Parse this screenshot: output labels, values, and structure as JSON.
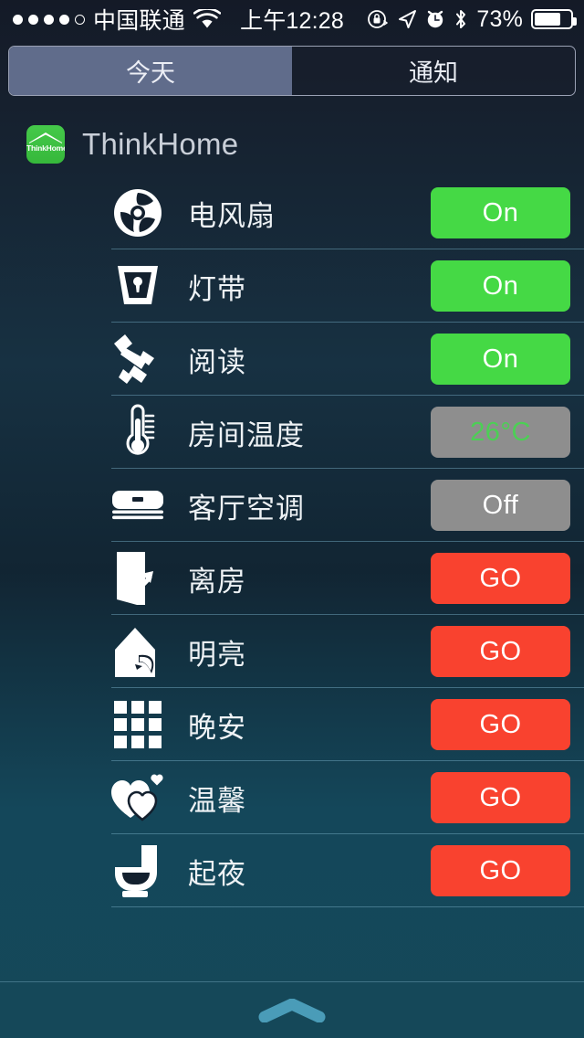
{
  "status_bar": {
    "signal_dots": [
      true,
      true,
      true,
      true,
      false
    ],
    "carrier": "中国联通",
    "wifi_icon": "wifi-icon",
    "time": "上午12:28",
    "icons": [
      "rotation-lock-icon",
      "location-arrow-icon",
      "alarm-clock-icon",
      "bluetooth-icon"
    ],
    "battery_percent": "73%",
    "battery_level": 73
  },
  "tabs": {
    "items": [
      {
        "label": "今天",
        "selected": true
      },
      {
        "label": "通知",
        "selected": false
      }
    ]
  },
  "widget": {
    "icon_brand": "ThinkHome",
    "title": "ThinkHome",
    "rows": [
      {
        "icon": "fan-icon",
        "label": "电风扇",
        "action": "On",
        "state": "on"
      },
      {
        "icon": "light-strip-icon",
        "label": "灯带",
        "action": "On",
        "state": "on"
      },
      {
        "icon": "desk-lamp-icon",
        "label": "阅读",
        "action": "On",
        "state": "on"
      },
      {
        "icon": "thermometer-icon",
        "label": "房间温度",
        "action": "26°C",
        "state": "value"
      },
      {
        "icon": "air-conditioner-icon",
        "label": "客厅空调",
        "action": "Off",
        "state": "off"
      },
      {
        "icon": "door-exit-icon",
        "label": "离房",
        "action": "GO",
        "state": "go"
      },
      {
        "icon": "house-icon",
        "label": "明亮",
        "action": "GO",
        "state": "go"
      },
      {
        "icon": "grid-icon",
        "label": "晚安",
        "action": "GO",
        "state": "go"
      },
      {
        "icon": "hearts-icon",
        "label": "温馨",
        "action": "GO",
        "state": "go"
      },
      {
        "icon": "toilet-icon",
        "label": "起夜",
        "action": "GO",
        "state": "go"
      }
    ]
  },
  "grabber": {
    "icon": "chevron-up-grabber-icon"
  },
  "colors": {
    "on_green": "#45d945",
    "off_gray": "#8e8e8e",
    "go_red": "#f9422f",
    "value_green": "#4ccf55",
    "tab_selected": "#606c8b",
    "grabber": "#4a9cb8"
  }
}
